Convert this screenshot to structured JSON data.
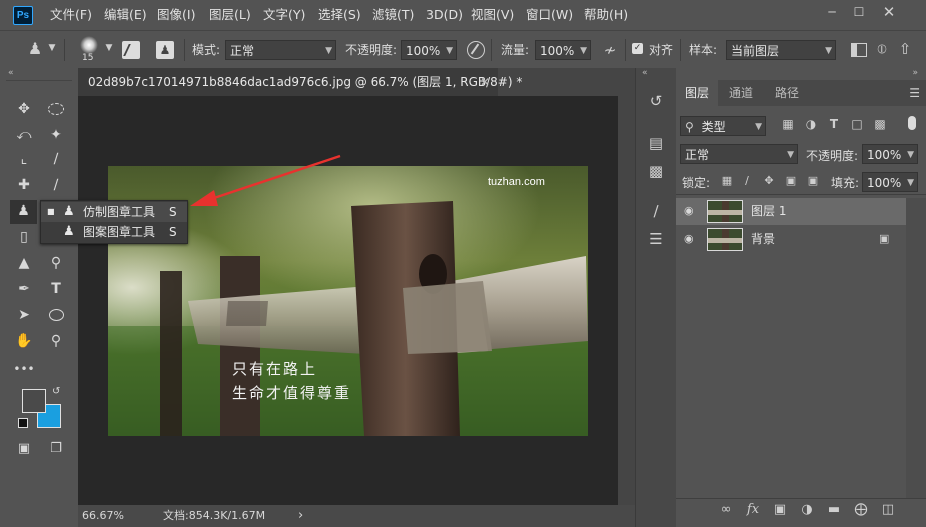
{
  "app": {
    "logo": "Ps"
  },
  "menubar": {
    "items": [
      "文件(F)",
      "编辑(E)",
      "图像(I)",
      "图层(L)",
      "文字(Y)",
      "选择(S)",
      "滤镜(T)",
      "3D(D)",
      "视图(V)",
      "窗口(W)",
      "帮助(H)"
    ],
    "window_controls": [
      "minimize",
      "maximize",
      "close"
    ]
  },
  "options_bar": {
    "brush_size": "15",
    "mode_label": "模式:",
    "mode_value": "正常",
    "opacity_label": "不透明度:",
    "opacity_value": "100%",
    "flow_label": "流量:",
    "flow_value": "100%",
    "aligned_label": "对齐",
    "aligned_checked": true,
    "sample_label": "样本:",
    "sample_value": "当前图层"
  },
  "document": {
    "tab_title": "02d89b7c17014971b8846dac1ad976c6.jpg @ 66.7% (图层 1, RGB/8#) *",
    "watermark": "tuzhan.com",
    "caption_line1": "只有在路上",
    "caption_line2": "生命才值得尊重"
  },
  "tool_flyout": {
    "items": [
      {
        "label": "仿制图章工具",
        "shortcut": "S",
        "active": true,
        "icon": "clone-stamp-icon"
      },
      {
        "label": "图案图章工具",
        "shortcut": "S",
        "active": false,
        "icon": "pattern-stamp-icon"
      }
    ]
  },
  "status_bar": {
    "zoom": "66.67%",
    "doc_info": "文档:854.3K/1.67M",
    "arrow": "›"
  },
  "layers_panel": {
    "tabs": [
      "图层",
      "通道",
      "路径"
    ],
    "active_tab": "图层",
    "filter_kind": "类型",
    "blend_mode": "正常",
    "opacity_label": "不透明度:",
    "opacity_value": "100%",
    "lock_label": "锁定:",
    "fill_label": "填充:",
    "fill_value": "100%",
    "layers": [
      {
        "name": "图层 1",
        "selected": true,
        "visible": true,
        "locked": false
      },
      {
        "name": "背景",
        "selected": false,
        "visible": true,
        "locked": true
      }
    ],
    "footer_buttons": [
      "link-icon",
      "fx-icon",
      "mask-icon",
      "adjustment-icon",
      "group-icon",
      "new-layer-icon",
      "trash-icon"
    ]
  },
  "colors": {
    "foreground": "#4a4a4a",
    "background": "#1a9fe0",
    "arrow_annotation": "#e8322e"
  }
}
